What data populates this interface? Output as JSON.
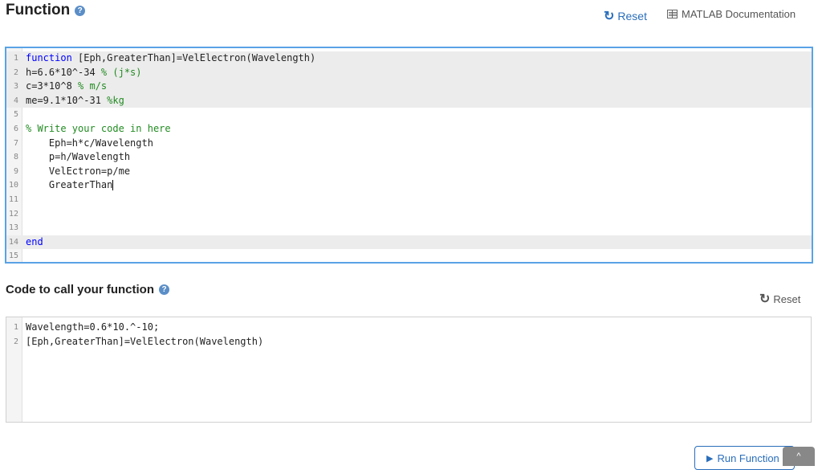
{
  "header": {
    "title": "Function",
    "help_glyph": "?",
    "reset_label": "Reset",
    "documentation_label": "MATLAB Documentation"
  },
  "function_editor": {
    "lines": [
      {
        "num": "1",
        "locked": true,
        "segments": [
          {
            "text": "function",
            "cls": "kw"
          },
          {
            "text": " [Eph,GreaterThan]=VelElectron(Wavelength)",
            "cls": ""
          }
        ]
      },
      {
        "num": "2",
        "locked": true,
        "segments": [
          {
            "text": "h=6.6*10^-34 ",
            "cls": ""
          },
          {
            "text": "% (j*s)",
            "cls": "cm"
          }
        ]
      },
      {
        "num": "3",
        "locked": true,
        "segments": [
          {
            "text": "c=3*10^8 ",
            "cls": ""
          },
          {
            "text": "% m/s",
            "cls": "cm"
          }
        ]
      },
      {
        "num": "4",
        "locked": true,
        "segments": [
          {
            "text": "me=9.1*10^-31 ",
            "cls": ""
          },
          {
            "text": "%kg",
            "cls": "cm"
          }
        ]
      },
      {
        "num": "5",
        "locked": false,
        "segments": []
      },
      {
        "num": "6",
        "locked": false,
        "segments": [
          {
            "text": "% Write your code in here",
            "cls": "cm"
          }
        ]
      },
      {
        "num": "7",
        "locked": false,
        "segments": [
          {
            "text": "    Eph=h*c/Wavelength",
            "cls": ""
          }
        ]
      },
      {
        "num": "8",
        "locked": false,
        "segments": [
          {
            "text": "    p=h/Wavelength",
            "cls": ""
          }
        ]
      },
      {
        "num": "9",
        "locked": false,
        "segments": [
          {
            "text": "    VelEctron=p/me",
            "cls": ""
          }
        ]
      },
      {
        "num": "10",
        "locked": false,
        "caret": true,
        "segments": [
          {
            "text": "    GreaterThan",
            "cls": ""
          }
        ]
      },
      {
        "num": "11",
        "locked": false,
        "segments": []
      },
      {
        "num": "12",
        "locked": false,
        "segments": []
      },
      {
        "num": "13",
        "locked": false,
        "segments": []
      },
      {
        "num": "14",
        "locked": true,
        "segments": [
          {
            "text": "end",
            "cls": "kw"
          }
        ]
      },
      {
        "num": "15",
        "locked": false,
        "segments": []
      }
    ]
  },
  "call_section": {
    "title": "Code to call your function",
    "help_glyph": "?",
    "reset_label": "Reset"
  },
  "call_editor": {
    "lines": [
      {
        "num": "1",
        "locked": false,
        "segments": [
          {
            "text": "Wavelength=0.6*10.^-10;",
            "cls": ""
          }
        ]
      },
      {
        "num": "2",
        "locked": false,
        "segments": [
          {
            "text": "[Eph,GreaterThan]=VelElectron(Wavelength)",
            "cls": ""
          }
        ]
      }
    ]
  },
  "actions": {
    "run_label": "Run Function",
    "scroll_top_glyph": "^"
  },
  "icons": {
    "help": "help-circle-icon",
    "reset": "refresh-icon",
    "documentation": "book-icon",
    "run": "play-icon",
    "scroll": "chevron-up-icon"
  },
  "colors": {
    "accent": "#2a6ebb",
    "focus_border": "#5aa2e6",
    "keyword": "#0000ff",
    "comment": "#228b22",
    "locked_line": "#ececec"
  }
}
